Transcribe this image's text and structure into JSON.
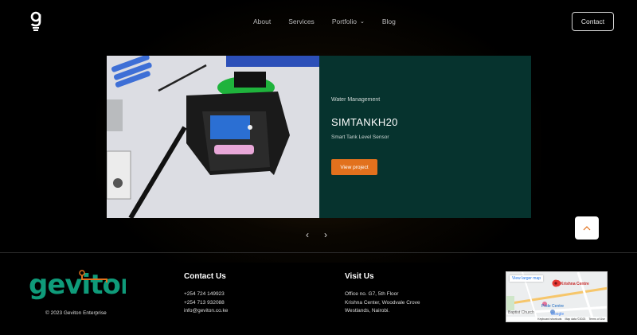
{
  "header": {
    "nav": [
      "About",
      "Services",
      "Portfolio",
      "Blog"
    ],
    "contact_label": "Contact"
  },
  "slide": {
    "category": "Water Management",
    "title": "SIMTANKH20",
    "subtitle": "Smart Tank Level Sensor",
    "cta": "View project"
  },
  "carousel": {
    "prev": "‹",
    "next": "›"
  },
  "scroll_top": "^",
  "footer": {
    "brand": "geviton",
    "copyright": "© 2023 Geviton Enterprise",
    "contact": {
      "heading": "Contact Us",
      "lines": [
        "+254 724 149923",
        "+254 713 932088",
        "info@geviton.co.ke"
      ]
    },
    "visit": {
      "heading": "Visit Us",
      "lines": [
        "Office no. G7, 5th Floor",
        "Krishna Center, Woodvale Crove",
        "Westlands, Nairobi."
      ]
    },
    "map": {
      "link": "View larger map",
      "place": "Krishna Centre",
      "labels": [
        "Pride Centre",
        "Baptist Church",
        "Google"
      ],
      "attribution": [
        "Keyboard shortcuts",
        "Map data ©2023",
        "Terms of Use"
      ]
    }
  },
  "colors": {
    "accent": "#e2711d",
    "panel": "#06332e",
    "brand_green": "#0f9b7a"
  }
}
